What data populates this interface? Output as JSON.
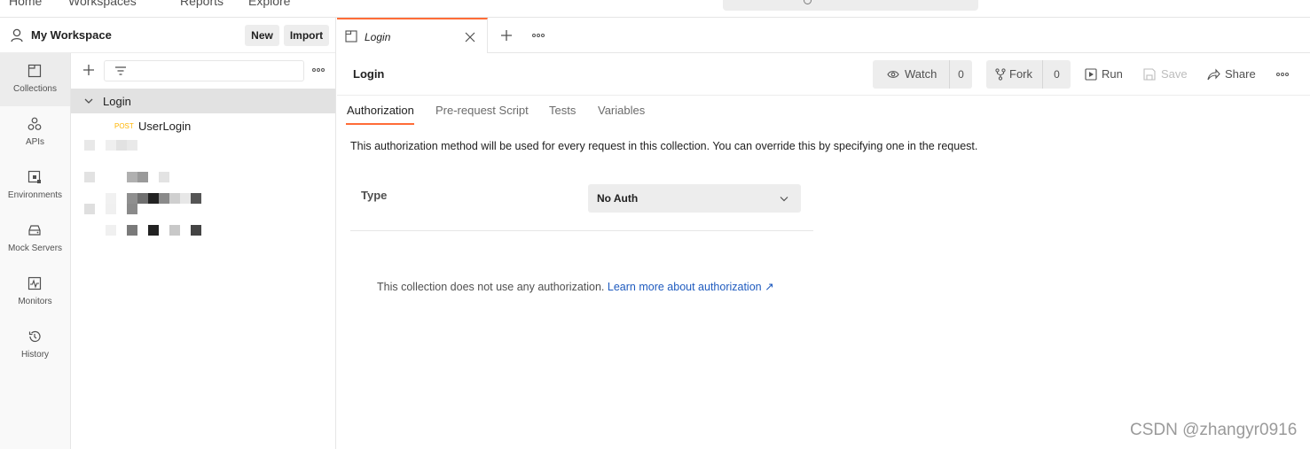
{
  "topbar": {
    "nav": [
      "Home",
      "Workspaces",
      "Reports",
      "Explore"
    ]
  },
  "workspace": {
    "title": "My Workspace",
    "new_label": "New",
    "import_label": "Import"
  },
  "rail": [
    {
      "label": "Collections",
      "icon": "collections-icon",
      "active": true
    },
    {
      "label": "APIs",
      "icon": "apis-icon"
    },
    {
      "label": "Environments",
      "icon": "environments-icon"
    },
    {
      "label": "Mock Servers",
      "icon": "mock-servers-icon"
    },
    {
      "label": "Monitors",
      "icon": "monitors-icon"
    },
    {
      "label": "History",
      "icon": "history-icon"
    }
  ],
  "tree": {
    "collection": "Login",
    "request": {
      "method": "POST",
      "name": "UserLogin"
    }
  },
  "tab": {
    "name": "Login"
  },
  "request_header": {
    "name": "Login",
    "watch_label": "Watch",
    "watch_count": "0",
    "fork_label": "Fork",
    "fork_count": "0",
    "run_label": "Run",
    "save_label": "Save",
    "share_label": "Share"
  },
  "subtabs": [
    "Authorization",
    "Pre-request Script",
    "Tests",
    "Variables"
  ],
  "auth": {
    "description": "This authorization method will be used for every request in this collection. You can override this by specifying one in the request.",
    "type_label": "Type",
    "type_value": "No Auth",
    "note": "This collection does not use any authorization.",
    "link": "Learn more about authorization ↗"
  },
  "watermark": "CSDN @zhangyr0916",
  "colors": {
    "accent": "#ff6c37",
    "method_post": "#ffb400",
    "link": "#1f5bbf"
  }
}
